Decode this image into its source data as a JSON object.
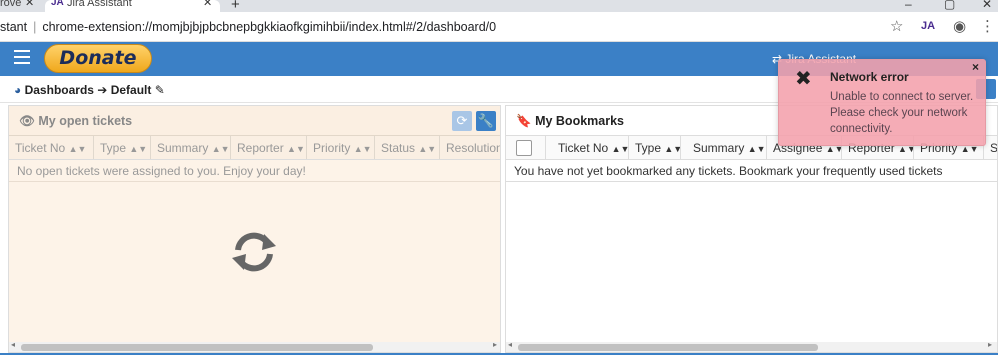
{
  "browser": {
    "tabs": [
      {
        "label": "rove",
        "active": false
      },
      {
        "label": "Jira Assistant",
        "active": true,
        "favicon": "JA"
      }
    ],
    "address": {
      "prefix": "stant",
      "url": "chrome-extension://momjbjbjpbcbnepbgkkiaofkgimihbii/index.html#/2/dashboard/0"
    },
    "extension_badge": "JA"
  },
  "header": {
    "donate_label": "Donate",
    "right_text": "⇄ Jira Assistant"
  },
  "breadcrumb": {
    "dashboards": "Dashboards",
    "arrow": "➔",
    "current": "Default"
  },
  "left_panel": {
    "title": "My open tickets",
    "columns": [
      "Ticket No",
      "Type",
      "Summary",
      "Reporter",
      "Priority",
      "Status",
      "Resolution"
    ],
    "empty_message": "No open tickets were assigned to you. Enjoy your day!"
  },
  "right_panel": {
    "title": "My Bookmarks",
    "columns": [
      "Ticket No",
      "Type",
      "Summary",
      "Assignee",
      "Reporter",
      "Priority",
      "S"
    ],
    "empty_message": "You have not yet bookmarked any tickets. Bookmark your frequently used tickets"
  },
  "toast": {
    "title": "Network error",
    "message": "Unable to connect to server. Please check your network connectivity.",
    "close": "×"
  },
  "colors": {
    "accent": "#3b80c6",
    "donate": "#f5b62d",
    "toast_bg": "#f4a0ac"
  }
}
